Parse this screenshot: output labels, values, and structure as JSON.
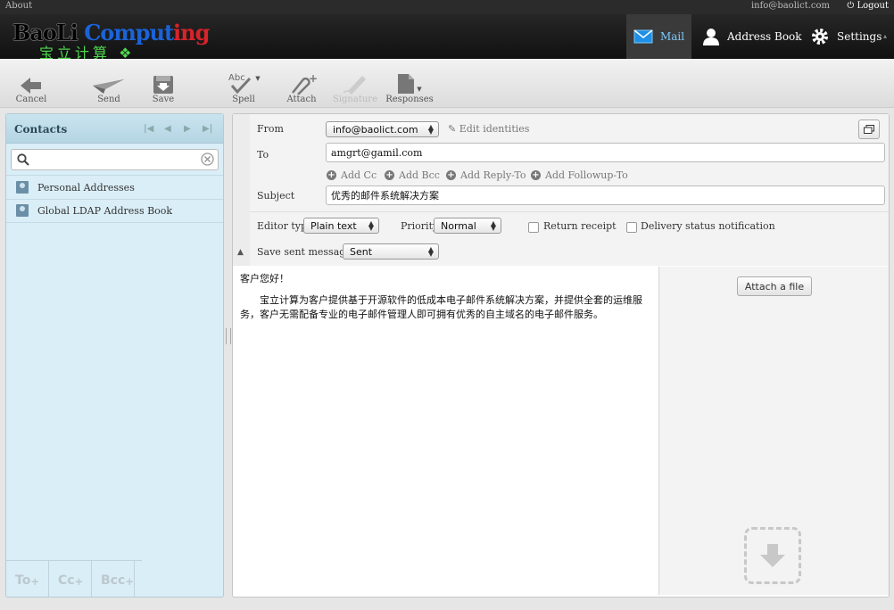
{
  "topbar": {
    "about": "About",
    "email": "info@baolict.com",
    "logout": "Logout"
  },
  "logo": {
    "part1": "BaoLi ",
    "part2": "Comput",
    "part3": "ing",
    "chinese": "宝立计算"
  },
  "nav": {
    "mail": "Mail",
    "address_book": "Address Book",
    "settings": "Settings"
  },
  "toolbar": {
    "cancel": "Cancel",
    "send": "Send",
    "save": "Save",
    "spell": "Spell",
    "attach": "Attach",
    "signature": "Signature",
    "responses": "Responses"
  },
  "contacts": {
    "title": "Contacts",
    "search_value": "",
    "books": [
      {
        "label": "Personal Addresses"
      },
      {
        "label": "Global LDAP Address Book"
      }
    ],
    "footer": {
      "to": "To",
      "cc": "Cc",
      "bcc": "Bcc"
    }
  },
  "compose": {
    "from_label": "From",
    "from_value": "info@baolict.com",
    "edit_identities": "Edit identities",
    "to_label": "To",
    "to_value": "amgrt@gamil.com",
    "add_cc": "Add Cc",
    "add_bcc": "Add Bcc",
    "add_reply_to": "Add Reply-To",
    "add_followup_to": "Add Followup-To",
    "subject_label": "Subject",
    "subject_value": "优秀的邮件系统解决方案",
    "editor_type_label": "Editor type",
    "editor_type_value": "Plain text",
    "priority_label": "Priority",
    "priority_value": "Normal",
    "return_receipt": "Return receipt",
    "delivery_status": "Delivery status notification",
    "save_sent_label": "Save sent message in",
    "save_sent_value": "Sent",
    "body_line1": "客户您好！",
    "body_line2": "宝立计算为客户提供基于开源软件的低成本电子邮件系统解决方案，并提供全套的运维服务，客户无需配备专业的电子邮件管理人即可拥有优秀的自主域名的电子邮件服务。",
    "attach_file": "Attach a file"
  }
}
